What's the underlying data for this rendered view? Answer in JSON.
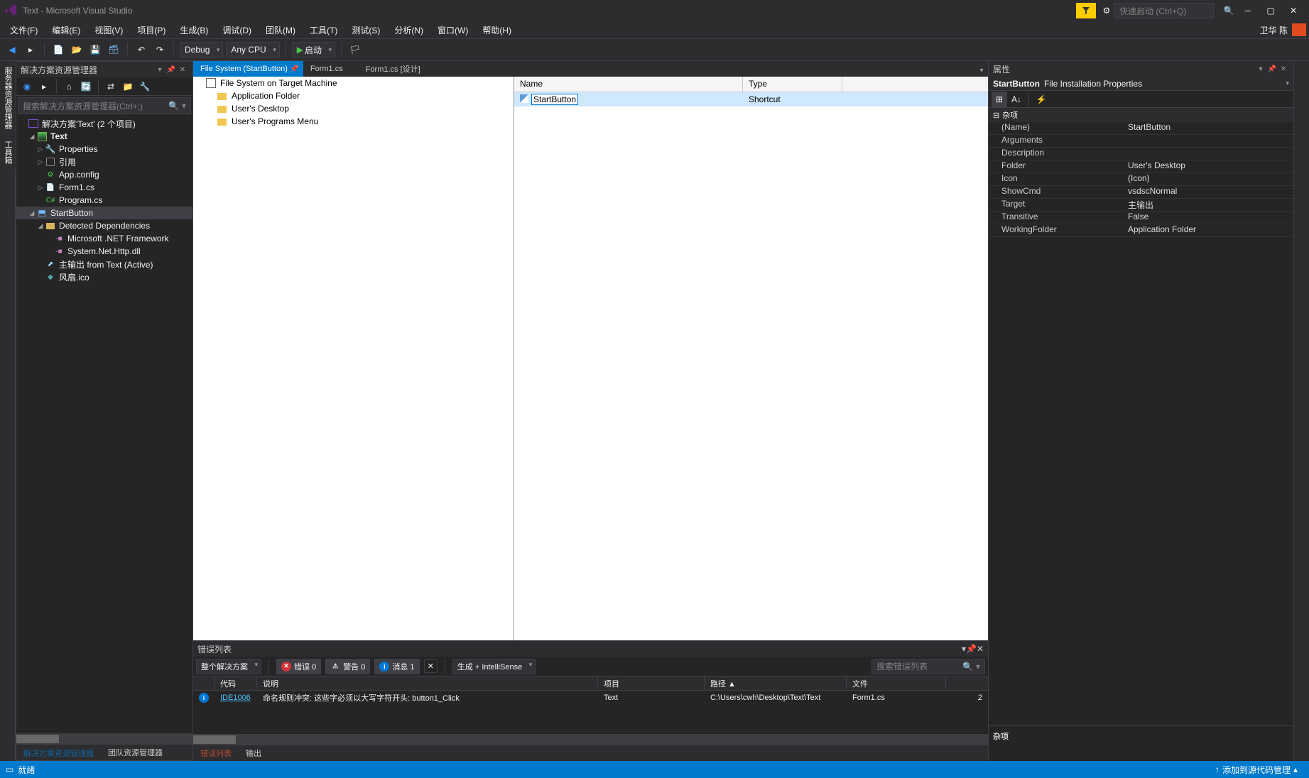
{
  "window": {
    "title": "Text - Microsoft Visual Studio",
    "quickLaunch": "快速启动 (Ctrl+Q)",
    "user": "卫华 陈"
  },
  "menu": {
    "file": "文件(F)",
    "edit": "编辑(E)",
    "view": "视图(V)",
    "project": "项目(P)",
    "build": "生成(B)",
    "debug": "调试(D)",
    "team": "团队(M)",
    "tools": "工具(T)",
    "test": "测试(S)",
    "analyze": "分析(N)",
    "window": "窗口(W)",
    "help": "帮助(H)"
  },
  "toolbar": {
    "config": "Debug",
    "platform": "Any CPU",
    "start": "启动"
  },
  "leftStrip": {
    "serverExplorer": "服务器资源管理器",
    "toolbox": "工具箱"
  },
  "solutionExplorer": {
    "title": "解决方案资源管理器",
    "searchPlaceholder": "搜索解决方案资源管理器(Ctrl+;)",
    "solution": "解决方案'Text' (2 个项目)",
    "projText": "Text",
    "properties": "Properties",
    "references": "引用",
    "appConfig": "App.config",
    "form1cs": "Form1.cs",
    "programcs": "Program.cs",
    "startButton": "StartButton",
    "detectedDeps": "Detected Dependencies",
    "netfx": "Microsoft .NET Framework",
    "httpDll": "System.Net.Http.dll",
    "primaryOutput": "主输出 from Text (Active)",
    "ico": "风扇.ico",
    "tabSolution": "解决方案资源管理器",
    "tabTeam": "团队资源管理器"
  },
  "docTabs": {
    "t1": "File System (StartButton)",
    "t2": "Form1.cs",
    "t3": "Form1.cs [设计]"
  },
  "fileSystem": {
    "root": "File System on Target Machine",
    "appFolder": "Application Folder",
    "userDesktop": "User's Desktop",
    "programsMenu": "User's Programs Menu",
    "colName": "Name",
    "colType": "Type",
    "rowName": "StartButton",
    "rowType": "Shortcut"
  },
  "errorList": {
    "title": "错误列表",
    "scope": "整个解决方案",
    "errors": "错误 0",
    "warnings": "警告 0",
    "messages": "消息 1",
    "buildIntelli": "生成 + IntelliSense",
    "searchPlaceholder": "搜索错误列表",
    "colCode": "代码",
    "colDesc": "说明",
    "colProject": "项目",
    "colPath": "路径 ▲",
    "colFile": "文件",
    "rowCode": "IDE1006",
    "rowDesc": "命名规则冲突: 这些字必须以大写字符开头: button1_Click",
    "rowProject": "Text",
    "rowPath": "C:\\Users\\cwh\\Desktop\\Text\\Text",
    "rowFile": "Form1.cs",
    "rowLine": "2",
    "tabErrors": "错误列表",
    "tabOutput": "输出"
  },
  "properties": {
    "title": "属性",
    "selectedBold": "StartButton",
    "selectedRest": "File Installation Properties",
    "catMisc": "杂项",
    "rows": {
      "name_k": "(Name)",
      "name_v": "StartButton",
      "args_k": "Arguments",
      "args_v": "",
      "desc_k": "Description",
      "desc_v": "",
      "folder_k": "Folder",
      "folder_v": "User's Desktop",
      "icon_k": "Icon",
      "icon_v": "(Icon)",
      "showcmd_k": "ShowCmd",
      "showcmd_v": "vsdscNormal",
      "target_k": "Target",
      "target_v": "主输出",
      "trans_k": "Transitive",
      "trans_v": "False",
      "wf_k": "WorkingFolder",
      "wf_v": "Application Folder"
    },
    "descTitle": "杂项"
  },
  "statusbar": {
    "ready": "就绪",
    "addSource": "添加到源代码管理"
  }
}
